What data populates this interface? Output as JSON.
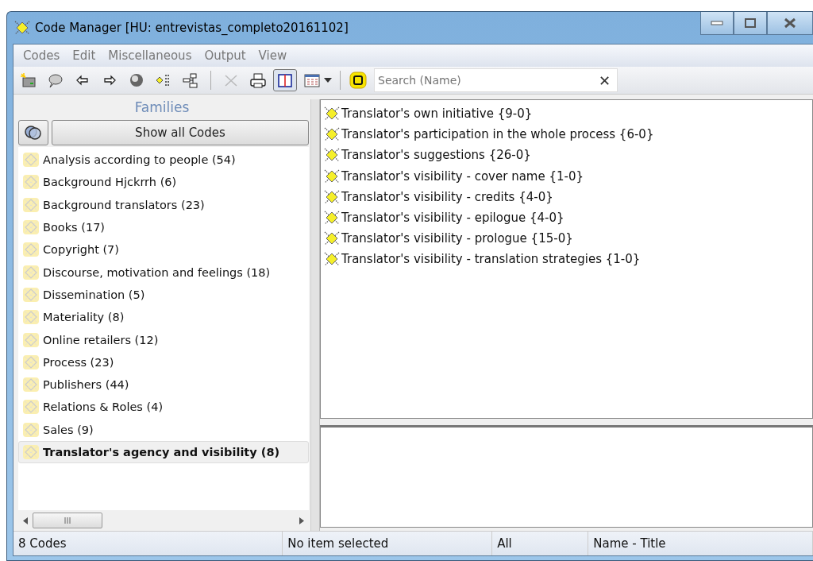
{
  "window": {
    "title": "Code Manager [HU: entrevistas_completo20161102]"
  },
  "menu": [
    "Codes",
    "Edit",
    "Miscellaneous",
    "Output",
    "View"
  ],
  "toolbar": [
    {
      "pressed": false
    },
    {
      "pressed": false
    },
    {
      "pressed": false
    },
    {
      "pressed": false
    },
    {
      "pressed": false
    },
    {
      "pressed": false
    },
    {
      "pressed": false
    },
    {
      "pressed": false,
      "disabled": true
    },
    {
      "pressed": false
    },
    {
      "pressed": true
    },
    {
      "pressed": false
    }
  ],
  "search": {
    "placeholder": "Search (Name)",
    "clear": "✕"
  },
  "families": {
    "title": "Families",
    "show_all": "Show all Codes",
    "items": [
      {
        "label": "Analysis according to people (54)",
        "selected": false
      },
      {
        "label": "Background Hjckrrh (6)",
        "selected": false
      },
      {
        "label": "Background translators (23)",
        "selected": false
      },
      {
        "label": "Books (17)",
        "selected": false
      },
      {
        "label": "Copyright (7)",
        "selected": false
      },
      {
        "label": "Discourse, motivation and feelings (18)",
        "selected": false
      },
      {
        "label": "Dissemination (5)",
        "selected": false
      },
      {
        "label": "Materiality (8)",
        "selected": false
      },
      {
        "label": "Online retailers (12)",
        "selected": false
      },
      {
        "label": "Process (23)",
        "selected": false
      },
      {
        "label": "Publishers (44)",
        "selected": false
      },
      {
        "label": "Relations & Roles (4)",
        "selected": false
      },
      {
        "label": "Sales (9)",
        "selected": false
      },
      {
        "label": "Translator's agency and visibility (8)",
        "selected": true
      }
    ]
  },
  "codes": [
    "Translator's own initiative {9-0}",
    "Translator's participation in the whole process {6-0}",
    "Translator's suggestions {26-0}",
    "Translator's visibility - cover name {1-0}",
    "Translator's visibility - credits {4-0}",
    "Translator's visibility - epilogue {4-0}",
    "Translator's visibility - prologue {15-0}",
    "Translator's visibility - translation strategies {1-0}"
  ],
  "status_bar": [
    "8 Codes",
    "No item selected",
    "All",
    "Name - Title"
  ]
}
